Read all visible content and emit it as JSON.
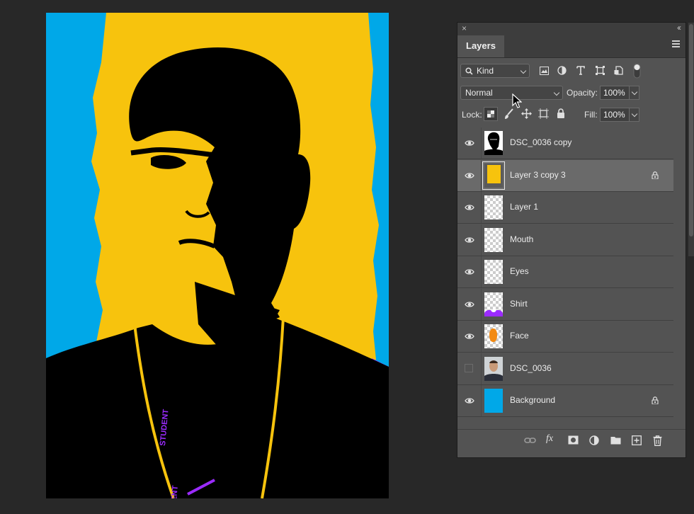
{
  "canvas": {
    "colors": {
      "background": "#00a8e8",
      "yellow": "#f7c30d",
      "shadow": "#000000",
      "accent": "#9b2bff"
    },
    "lanyard_text": "STUDENT",
    "lanyard_text_bottom": "ENT"
  },
  "panel": {
    "close_glyph": "×",
    "collapse_glyph": "‹‹",
    "tab_label": "Layers",
    "filter": {
      "kind_label": "Kind",
      "icons": [
        "image-filter-icon",
        "adjustment-filter-icon",
        "type-filter-icon",
        "shape-filter-icon",
        "smart-object-filter-icon",
        "filter-toggle-icon"
      ]
    },
    "blend_mode": "Normal",
    "opacity_label": "Opacity:",
    "opacity_value": "100%",
    "lock_label": "Lock:",
    "fill_label": "Fill:",
    "fill_value": "100%",
    "layers": [
      {
        "name": "DSC_0036 copy",
        "visible": true,
        "locked": false,
        "selected": false,
        "thumb": "photo-bw"
      },
      {
        "name": "Layer 3 copy 3",
        "visible": true,
        "locked": true,
        "selected": true,
        "thumb": "yellow"
      },
      {
        "name": "Layer 1",
        "visible": true,
        "locked": false,
        "selected": false,
        "thumb": "transparent"
      },
      {
        "name": "Mouth",
        "visible": true,
        "locked": false,
        "selected": false,
        "thumb": "transparent"
      },
      {
        "name": "Eyes",
        "visible": true,
        "locked": false,
        "selected": false,
        "thumb": "transparent"
      },
      {
        "name": "Shirt",
        "visible": true,
        "locked": false,
        "selected": false,
        "thumb": "shirt"
      },
      {
        "name": "Face",
        "visible": true,
        "locked": false,
        "selected": false,
        "thumb": "face"
      },
      {
        "name": "DSC_0036",
        "visible": false,
        "locked": false,
        "selected": false,
        "thumb": "photo"
      },
      {
        "name": "Background",
        "visible": true,
        "locked": true,
        "selected": false,
        "thumb": "blue"
      }
    ],
    "bottom_icons": [
      "link-layers-icon",
      "fx-icon",
      "add-mask-icon",
      "adjustment-layer-icon",
      "new-group-icon",
      "new-layer-icon",
      "delete-layer-icon"
    ],
    "fx_label": "fx"
  }
}
